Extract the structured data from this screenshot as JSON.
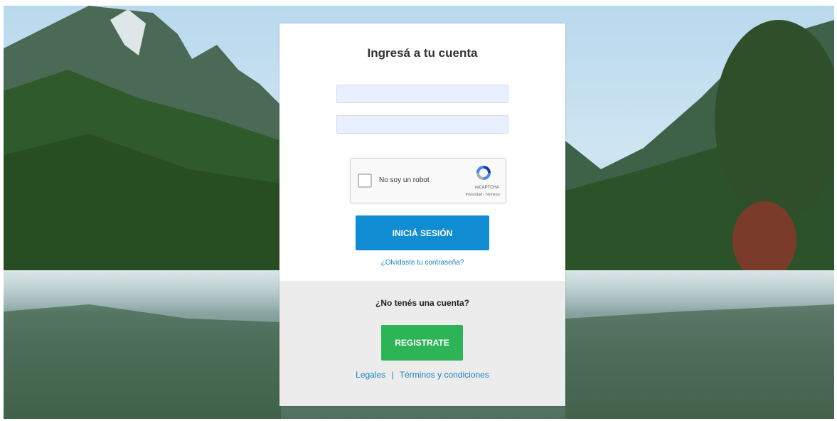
{
  "login": {
    "title": "Ingresá a tu cuenta",
    "username_value": "",
    "password_value": "",
    "captcha_label": "No soy un robot",
    "captcha_brand": "reCAPTCHA",
    "captcha_privacy": "Privacidad",
    "captcha_terms": "Términos",
    "submit_label": "INICIÁ SESIÓN",
    "forgot_link": "¿Olvidaste tu contraseña?"
  },
  "signup": {
    "prompt": "¿No tenés una cuenta?",
    "register_label": "REGISTRATE"
  },
  "footer": {
    "legales": "Legales",
    "separator": "|",
    "terms": "Términos y condiciones"
  },
  "colors": {
    "primary_button": "#0f8cd2",
    "register_button": "#2db457",
    "link": "#1a82c4"
  }
}
